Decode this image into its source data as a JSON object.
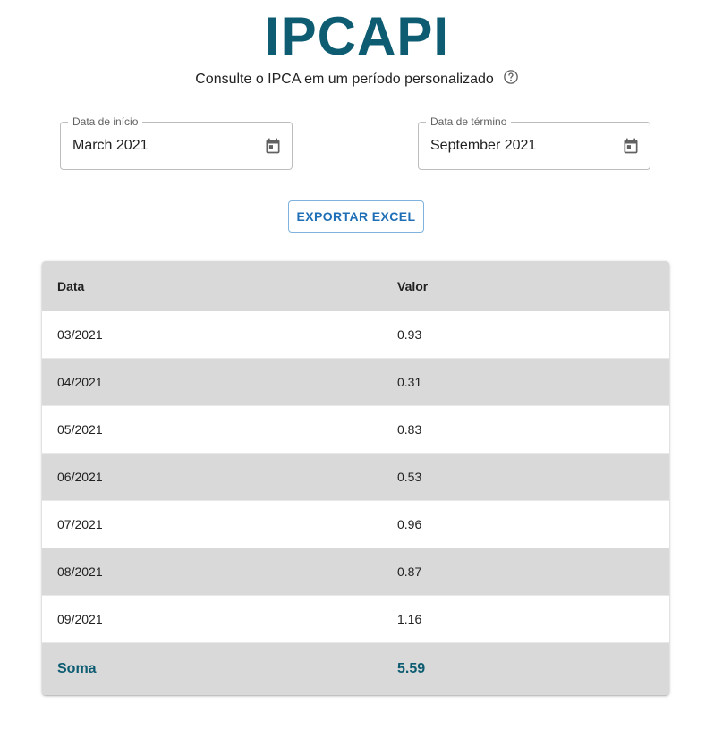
{
  "app": {
    "title": "IPCAPI",
    "subtitle": "Consulte o IPCA em um período personalizado"
  },
  "icons": {
    "help": "help-circle-icon",
    "calendar": "calendar-icon"
  },
  "colors": {
    "brand": "#0d5c72",
    "button_text": "#1e6fb5",
    "row_alt": "#d9d9d9"
  },
  "filters": {
    "start": {
      "label": "Data de início",
      "value": "March 2021"
    },
    "end": {
      "label": "Data de término",
      "value": "September 2021"
    }
  },
  "export": {
    "label": "EXPORTAR EXCEL"
  },
  "table": {
    "columns": [
      "Data",
      "Valor"
    ],
    "rows": [
      [
        "03/2021",
        "0.93"
      ],
      [
        "04/2021",
        "0.31"
      ],
      [
        "05/2021",
        "0.83"
      ],
      [
        "06/2021",
        "0.53"
      ],
      [
        "07/2021",
        "0.96"
      ],
      [
        "08/2021",
        "0.87"
      ],
      [
        "09/2021",
        "1.16"
      ]
    ],
    "total": {
      "label": "Soma",
      "value": "5.59"
    }
  }
}
